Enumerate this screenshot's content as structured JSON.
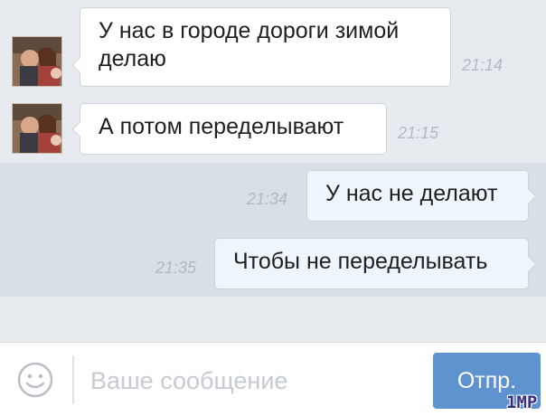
{
  "messages": [
    {
      "direction": "in",
      "text_lines": [
        "У нас в городе дороги зимой",
        "делаю"
      ],
      "time": "21:14"
    },
    {
      "direction": "in",
      "text_lines": [
        "А потом переделывают"
      ],
      "time": "21:15"
    },
    {
      "direction": "out",
      "text_lines": [
        "У нас не делают"
      ],
      "time": "21:34"
    },
    {
      "direction": "out",
      "text_lines": [
        "Чтобы не переделывать"
      ],
      "time": "21:35"
    }
  ],
  "composer": {
    "placeholder": "Ваше сообщение",
    "send_label": "Отпр.",
    "emoji_icon": "smiley-icon"
  },
  "watermark": "1MP",
  "colors": {
    "chat_bg": "#e7ebf0",
    "outgoing_band": "#d8dfe7",
    "outgoing_bubble": "#eef6fd",
    "incoming_bubble": "#ffffff",
    "timestamp": "#b2b9c2",
    "send_button": "#5e93d0"
  }
}
